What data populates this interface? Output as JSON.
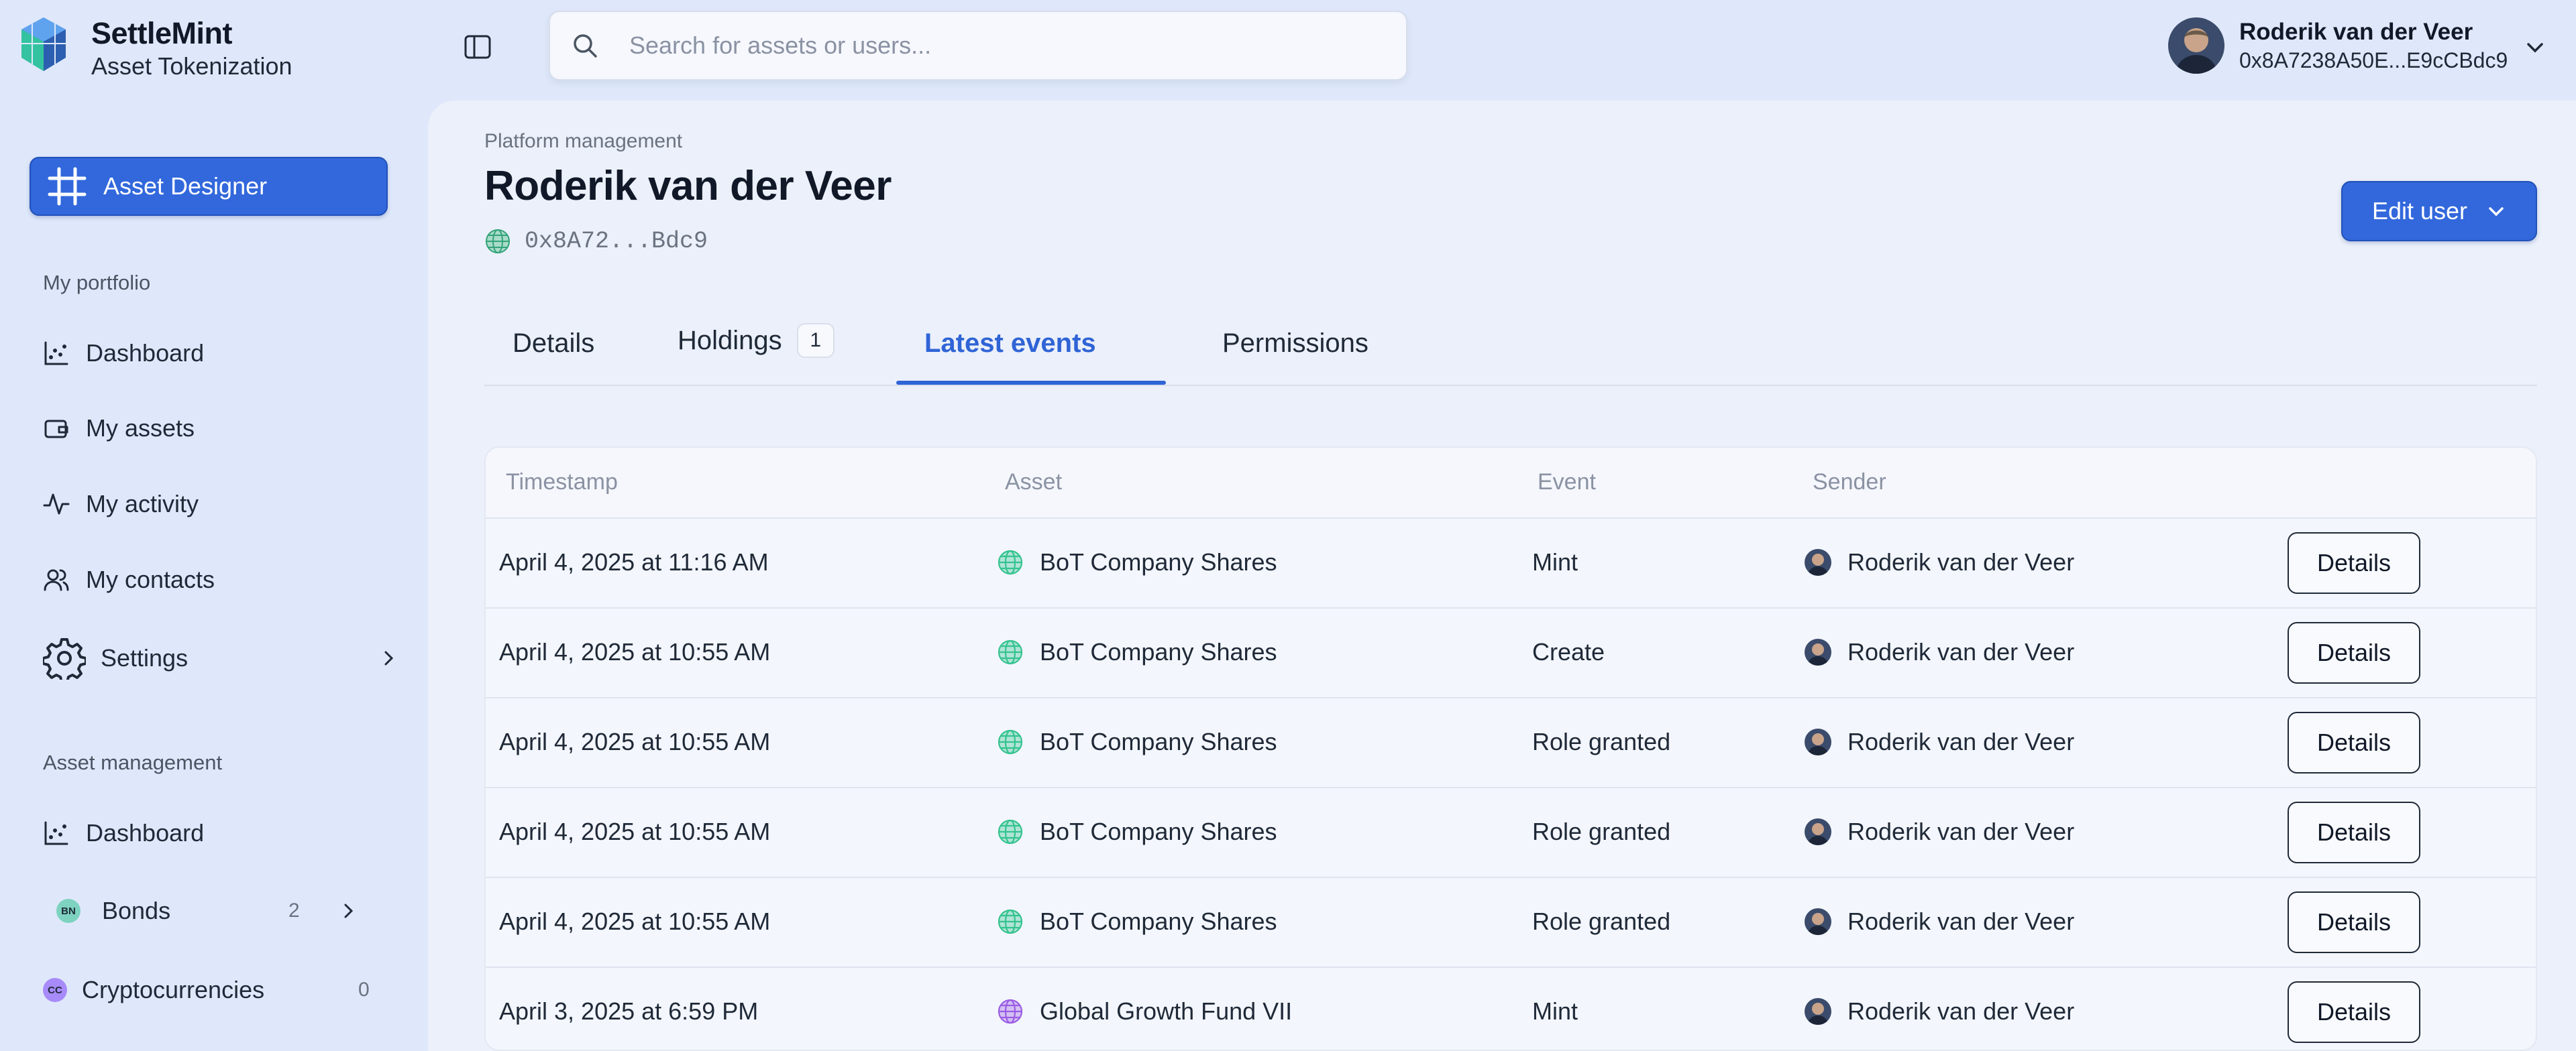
{
  "brand": {
    "name": "SettleMint",
    "subtitle": "Asset Tokenization"
  },
  "sidebar": {
    "designer_label": "Asset Designer",
    "portfolio_label": "My portfolio",
    "portfolio_items": [
      {
        "label": "Dashboard",
        "icon": "chart-icon"
      },
      {
        "label": "My assets",
        "icon": "wallet-icon"
      },
      {
        "label": "My activity",
        "icon": "activity-icon"
      },
      {
        "label": "My contacts",
        "icon": "users-icon"
      },
      {
        "label": "Settings",
        "icon": "gear-icon"
      }
    ],
    "asset_mgmt_label": "Asset management",
    "asset_items": [
      {
        "label": "Dashboard",
        "icon": "chart-icon"
      },
      {
        "label": "Bonds",
        "badge": "BN",
        "count": "2",
        "color": "#7dd3c0"
      },
      {
        "label": "Cryptocurrencies",
        "badge": "CC",
        "count": "0",
        "color": "#a78bfa"
      }
    ]
  },
  "search": {
    "placeholder": "Search for assets or users..."
  },
  "user": {
    "name": "Roderik van der Veer",
    "address": "0x8A7238A50E...E9cCBdc9"
  },
  "page": {
    "breadcrumb": "Platform management",
    "title": "Roderik van der Veer",
    "address": "0x8A72...Bdc9",
    "edit_label": "Edit user"
  },
  "tabs": [
    {
      "label": "Details"
    },
    {
      "label": "Holdings",
      "badge": "1"
    },
    {
      "label": "Latest events",
      "active": true
    },
    {
      "label": "Permissions"
    }
  ],
  "table": {
    "headers": [
      "Timestamp",
      "Asset",
      "Event",
      "Sender"
    ],
    "details_label": "Details",
    "rows": [
      {
        "timestamp": "April 4, 2025 at 11:16 AM",
        "asset": "BoT Company Shares",
        "event": "Mint",
        "sender": "Roderik van der Veer",
        "asset_color": "#34c38f"
      },
      {
        "timestamp": "April 4, 2025 at 10:55 AM",
        "asset": "BoT Company Shares",
        "event": "Create",
        "sender": "Roderik van der Veer",
        "asset_color": "#34c38f"
      },
      {
        "timestamp": "April 4, 2025 at 10:55 AM",
        "asset": "BoT Company Shares",
        "event": "Role granted",
        "sender": "Roderik van der Veer",
        "asset_color": "#34c38f"
      },
      {
        "timestamp": "April 4, 2025 at 10:55 AM",
        "asset": "BoT Company Shares",
        "event": "Role granted",
        "sender": "Roderik van der Veer",
        "asset_color": "#34c38f"
      },
      {
        "timestamp": "April 4, 2025 at 10:55 AM",
        "asset": "BoT Company Shares",
        "event": "Role granted",
        "sender": "Roderik van der Veer",
        "asset_color": "#34c38f"
      },
      {
        "timestamp": "April 3, 2025 at 6:59 PM",
        "asset": "Global Growth Fund VII",
        "event": "Mint",
        "sender": "Roderik van der Veer",
        "asset_color": "#9b5de5"
      }
    ]
  },
  "colors": {
    "accent": "#3268dc",
    "active_tab": "#2f64d6"
  }
}
